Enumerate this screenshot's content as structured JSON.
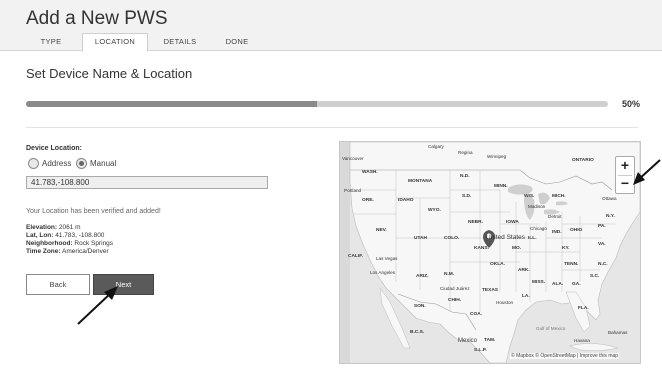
{
  "header": {
    "title": "Add a New PWS",
    "tabs": [
      {
        "label": "TYPE",
        "active": false
      },
      {
        "label": "LOCATION",
        "active": true
      },
      {
        "label": "DETAILS",
        "active": false
      },
      {
        "label": "DONE",
        "active": false
      }
    ]
  },
  "section": {
    "title": "Set Device Name & Location"
  },
  "progress": {
    "value": 0.5,
    "label": "50%"
  },
  "form": {
    "device_location_label": "Device Location:",
    "radio_address": "Address",
    "radio_manual": "Manual",
    "selected_mode": "Manual",
    "location_value": "41.783,-108.800",
    "verified_message": "Your Location has been verified and added!",
    "elevation_label": "Elevation:",
    "elevation_value": "2061 m",
    "latlon_label": "Lat, Lon:",
    "latlon_value": "41.783, -108.800",
    "neighborhood_label": "Neighborhood:",
    "neighborhood_value": "Rock Springs",
    "timezone_label": "Time Zone:",
    "timezone_value": "America/Denver"
  },
  "buttons": {
    "back": "Back",
    "next": "Next"
  },
  "map": {
    "zoom_in": "+",
    "zoom_out": "−",
    "attribution": "© Mapbox © OpenStreetMap | Improve this map",
    "labels": [
      {
        "text": "Calgary",
        "bold": false
      },
      {
        "text": "Regina",
        "bold": false
      },
      {
        "text": "Winnipeg",
        "bold": false
      },
      {
        "text": "Vancouver",
        "bold": false
      },
      {
        "text": "ONTARIO",
        "bold": true
      },
      {
        "text": "WASH.",
        "bold": true
      },
      {
        "text": "MONTANA",
        "bold": true
      },
      {
        "text": "N.D.",
        "bold": true
      },
      {
        "text": "MINN.",
        "bold": true
      },
      {
        "text": "Portland",
        "bold": false
      },
      {
        "text": "ORE.",
        "bold": true
      },
      {
        "text": "IDAHO",
        "bold": true
      },
      {
        "text": "S.D.",
        "bold": true
      },
      {
        "text": "WIS.",
        "bold": true
      },
      {
        "text": "MICH.",
        "bold": true
      },
      {
        "text": "Ottawa",
        "bold": false
      },
      {
        "text": "WYO.",
        "bold": true
      },
      {
        "text": "Madison",
        "bold": false
      },
      {
        "text": "Detroit",
        "bold": false
      },
      {
        "text": "N.Y.",
        "bold": true
      },
      {
        "text": "NEBR.",
        "bold": true
      },
      {
        "text": "IOWA",
        "bold": true
      },
      {
        "text": "Chicago",
        "bold": false
      },
      {
        "text": "NEV.",
        "bold": true
      },
      {
        "text": "UTAH",
        "bold": true
      },
      {
        "text": "COLO.",
        "bold": true
      },
      {
        "text": "United States",
        "bold": false
      },
      {
        "text": "ILL.",
        "bold": true
      },
      {
        "text": "IND.",
        "bold": true
      },
      {
        "text": "OHIO",
        "bold": true
      },
      {
        "text": "PA.",
        "bold": true
      },
      {
        "text": "KANS.",
        "bold": true
      },
      {
        "text": "MO.",
        "bold": true
      },
      {
        "text": "KY.",
        "bold": true
      },
      {
        "text": "VA.",
        "bold": true
      },
      {
        "text": "CALIF.",
        "bold": true
      },
      {
        "text": "Las Vegas",
        "bold": false
      },
      {
        "text": "OKLA.",
        "bold": true
      },
      {
        "text": "TENN.",
        "bold": true
      },
      {
        "text": "N.C.",
        "bold": true
      },
      {
        "text": "Los Angeles",
        "bold": false
      },
      {
        "text": "ARIZ.",
        "bold": true
      },
      {
        "text": "N.M.",
        "bold": true
      },
      {
        "text": "ARK.",
        "bold": true
      },
      {
        "text": "S.C.",
        "bold": true
      },
      {
        "text": "Ciudad Juárez",
        "bold": false
      },
      {
        "text": "MISS.",
        "bold": true
      },
      {
        "text": "ALA.",
        "bold": true
      },
      {
        "text": "GA.",
        "bold": true
      },
      {
        "text": "TEXAS",
        "bold": true
      },
      {
        "text": "CHIH.",
        "bold": true
      },
      {
        "text": "LA.",
        "bold": true
      },
      {
        "text": "SON.",
        "bold": true
      },
      {
        "text": "Houston",
        "bold": false
      },
      {
        "text": "FLA.",
        "bold": true
      },
      {
        "text": "COA.",
        "bold": true
      },
      {
        "text": "B.C.S.",
        "bold": true
      },
      {
        "text": "Mexico",
        "bold": false
      },
      {
        "text": "TAM.",
        "bold": true
      },
      {
        "text": "S.L.P.",
        "bold": true
      },
      {
        "text": "Havana",
        "bold": false
      },
      {
        "text": "Bahamas",
        "bold": false
      },
      {
        "text": "Gulf of Mexico",
        "bold": false
      }
    ]
  }
}
